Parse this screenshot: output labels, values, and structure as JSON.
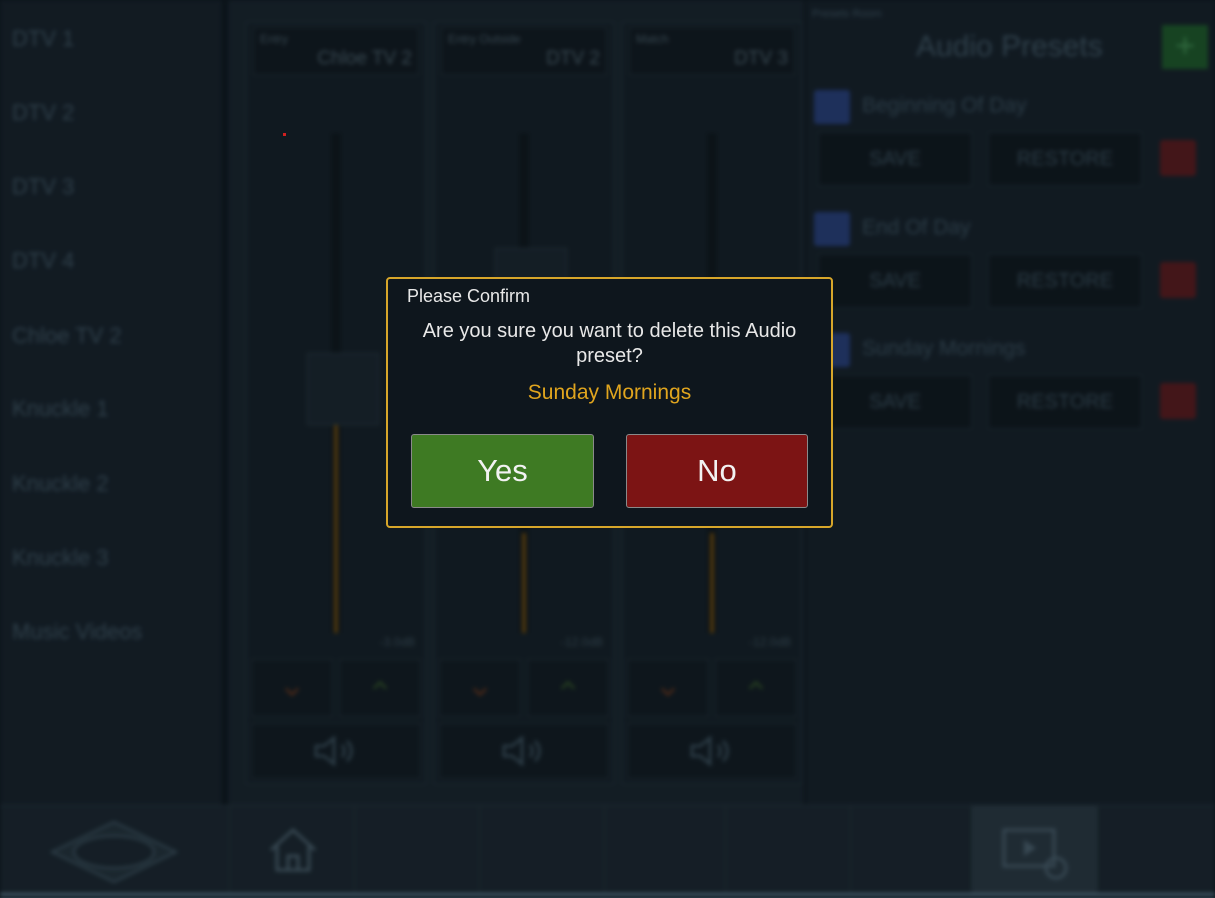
{
  "sidebar": {
    "items": [
      {
        "label": "DTV 1"
      },
      {
        "label": "DTV 2"
      },
      {
        "label": "DTV 3"
      },
      {
        "label": "DTV 4"
      },
      {
        "label": "Chloe TV 2"
      },
      {
        "label": "Knuckle 1"
      },
      {
        "label": "Knuckle 2"
      },
      {
        "label": "Knuckle 3"
      },
      {
        "label": "Music Videos"
      }
    ]
  },
  "mixer": {
    "channels": [
      {
        "label": "Entry",
        "name": "Chloe TV 2",
        "db": "-3.0dB",
        "level": 0.46
      },
      {
        "label": "Entry Outside",
        "name": "DTV 2",
        "db": "-12.0dB",
        "level": 0.2
      },
      {
        "label": "Match",
        "name": "DTV 3",
        "db": "-12.0dB",
        "level": 0.2
      }
    ]
  },
  "presets": {
    "tag": "Presets Room",
    "title": "Audio Presets",
    "add_label": "+",
    "save_label": "SAVE",
    "restore_label": "RESTORE",
    "items": [
      {
        "name": "Beginning Of Day"
      },
      {
        "name": "End Of Day"
      },
      {
        "name": "Sunday Mornings"
      }
    ]
  },
  "dialog": {
    "title": "Please Confirm",
    "message": "Are you sure you want to delete this Audio preset?",
    "preset_name": "Sunday Mornings",
    "yes_label": "Yes",
    "no_label": "No"
  },
  "colors": {
    "accent": "#d7a62a",
    "confirm": "#3e7a23",
    "cancel": "#7c1414",
    "preset_highlight": "#e0a51e"
  },
  "icons": {
    "logo": "venue-logo-icon",
    "home": "home-icon",
    "media": "media-player-icon",
    "speaker": "speaker-icon",
    "chevron_down": "chevron-down-icon",
    "chevron_up": "chevron-up-icon"
  }
}
